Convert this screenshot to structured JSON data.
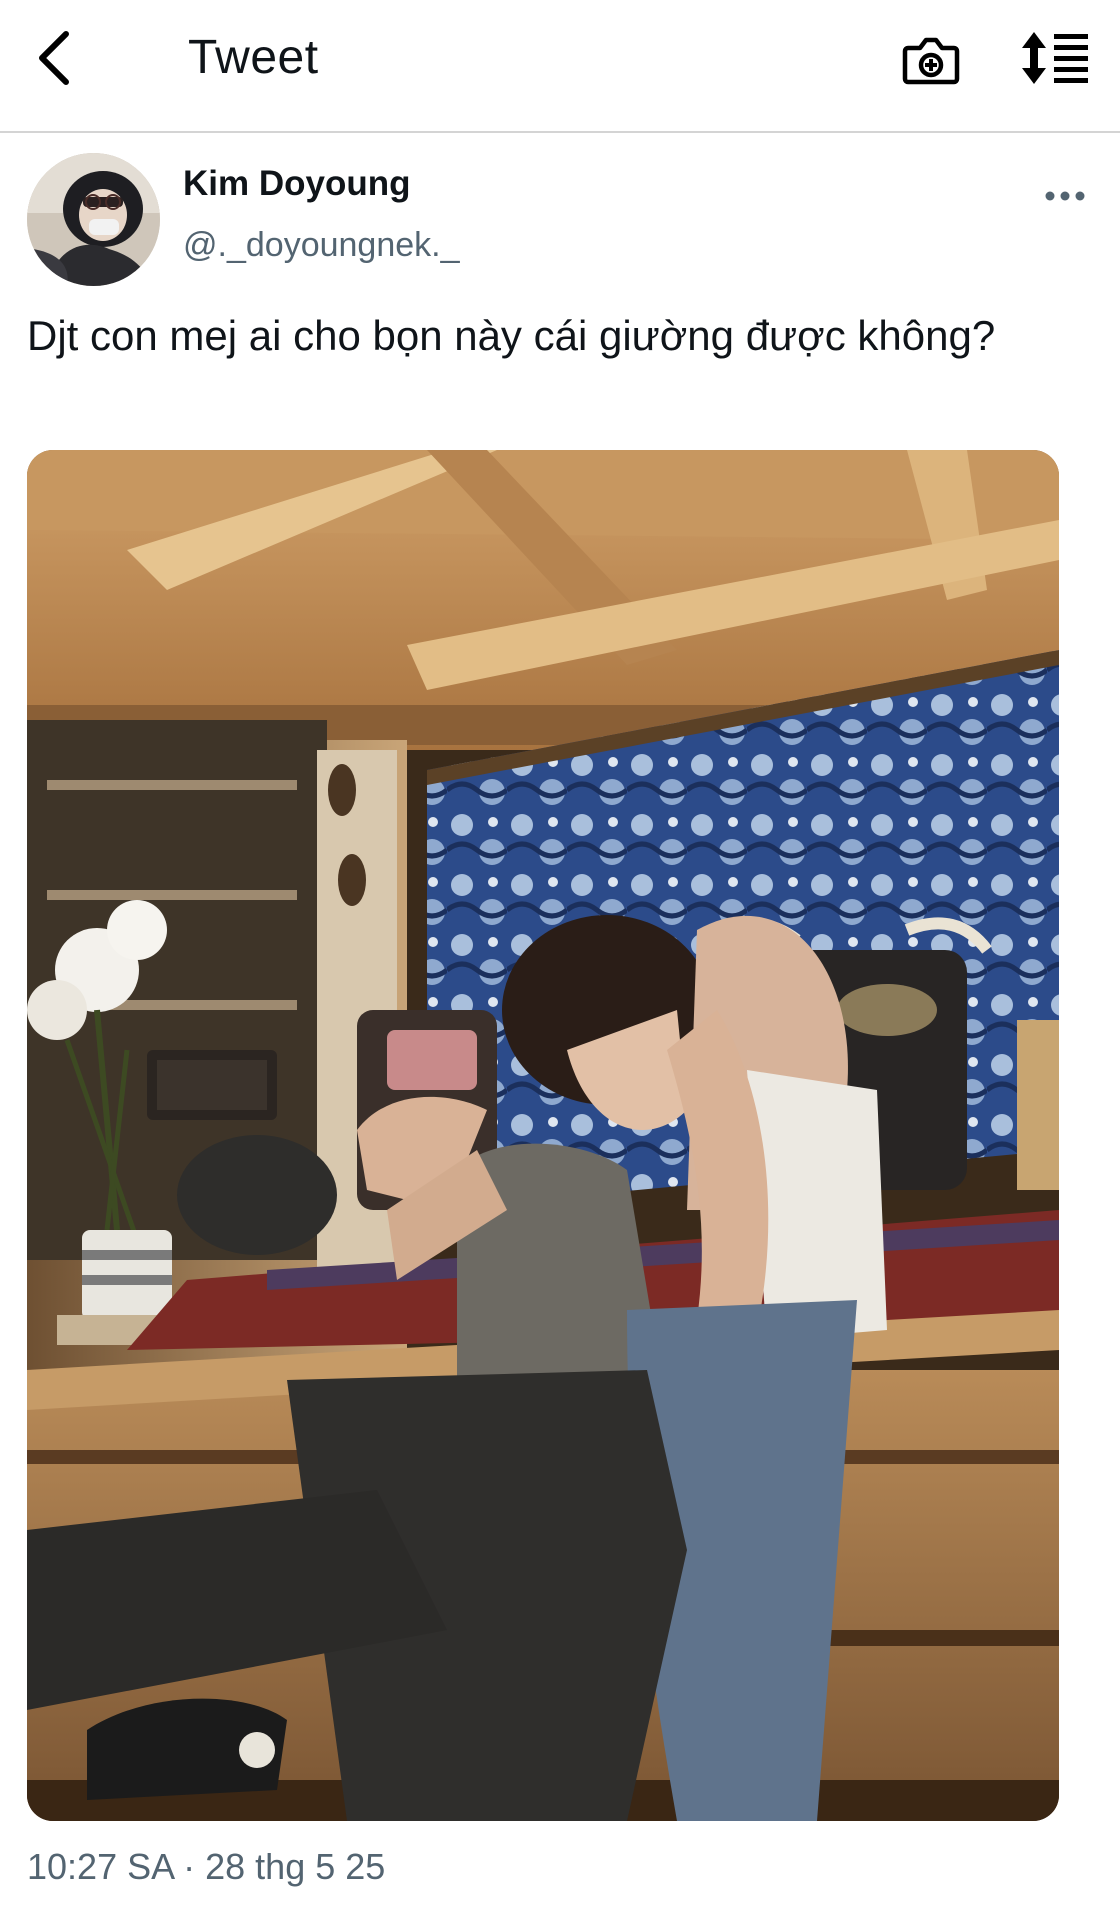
{
  "header": {
    "back_icon": "chevron-left-icon",
    "title": "Tweet",
    "camera_icon": "camera-plus-icon",
    "sort_icon": "sort-list-icon"
  },
  "tweet": {
    "author": {
      "display_name": "Kim Doyoung",
      "handle": "@._doyoungnek._"
    },
    "more_icon": "more-dots-icon",
    "text": "Djt con mej ai cho bọn này cái giường được không?",
    "media": {
      "type": "photo"
    },
    "timestamp": "10:27 SA · 28 thg 5 25"
  }
}
